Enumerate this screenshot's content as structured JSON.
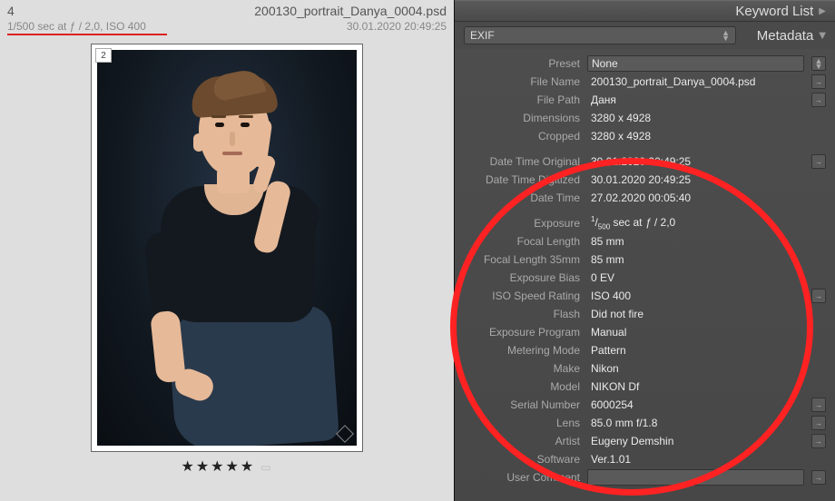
{
  "left": {
    "index": "4",
    "filename": "200130_portrait_Danya_0004.psd",
    "exposure_line": "1/500 sec at ƒ / 2,0, ISO 400",
    "datetime": "30.01.2020 20:49:25",
    "seq_badge": "2",
    "stars": "★★★★★"
  },
  "sections": {
    "keyword_list": "Keyword List",
    "metadata": "Metadata"
  },
  "exif_dropdown": {
    "value": "EXIF"
  },
  "preset": {
    "label": "Preset",
    "value": "None"
  },
  "meta": [
    {
      "group": 0,
      "icon": true,
      "label": "File Name",
      "value": "200130_portrait_Danya_0004.psd"
    },
    {
      "group": 0,
      "icon": true,
      "label": "File Path",
      "value": "Даня"
    },
    {
      "group": 0,
      "icon": false,
      "label": "Dimensions",
      "value": "3280 x 4928"
    },
    {
      "group": 0,
      "icon": false,
      "label": "Cropped",
      "value": "3280 x 4928"
    },
    {
      "group": 1,
      "icon": true,
      "label": "Date Time Original",
      "value": "30.01.2020 20:49:25"
    },
    {
      "group": 1,
      "icon": false,
      "label": "Date Time Digitized",
      "value": "30.01.2020 20:49:25"
    },
    {
      "group": 1,
      "icon": false,
      "label": "Date Time",
      "value": "27.02.2020 00:05:40"
    },
    {
      "group": 2,
      "icon": false,
      "label": "Exposure",
      "value_html": "<sup>1</sup>/<sub>500</sub> sec at <span class='ital'>ƒ</span> / 2,0"
    },
    {
      "group": 2,
      "icon": false,
      "label": "Focal Length",
      "value": "85 mm"
    },
    {
      "group": 2,
      "icon": false,
      "label": "Focal Length 35mm",
      "value": "85 mm"
    },
    {
      "group": 2,
      "icon": false,
      "label": "Exposure Bias",
      "value": "0 EV"
    },
    {
      "group": 2,
      "icon": true,
      "label": "ISO Speed Rating",
      "value": "ISO 400"
    },
    {
      "group": 2,
      "icon": false,
      "label": "Flash",
      "value": "Did not fire"
    },
    {
      "group": 2,
      "icon": false,
      "label": "Exposure Program",
      "value": "Manual"
    },
    {
      "group": 2,
      "icon": false,
      "label": "Metering Mode",
      "value": "Pattern"
    },
    {
      "group": 2,
      "icon": false,
      "label": "Make",
      "value": "Nikon"
    },
    {
      "group": 2,
      "icon": false,
      "label": "Model",
      "value": "NIKON Df"
    },
    {
      "group": 2,
      "icon": true,
      "label": "Serial Number",
      "value": "6000254"
    },
    {
      "group": 2,
      "icon": true,
      "label": "Lens",
      "value": "85.0 mm f/1.8"
    },
    {
      "group": 2,
      "icon": true,
      "label": "Artist",
      "value": "Eugeny Demshin"
    },
    {
      "group": 2,
      "icon": false,
      "label": "Software",
      "value": "Ver.1.01"
    },
    {
      "group": 2,
      "icon": true,
      "label": "User Comment",
      "value": "",
      "boxed": true
    }
  ]
}
